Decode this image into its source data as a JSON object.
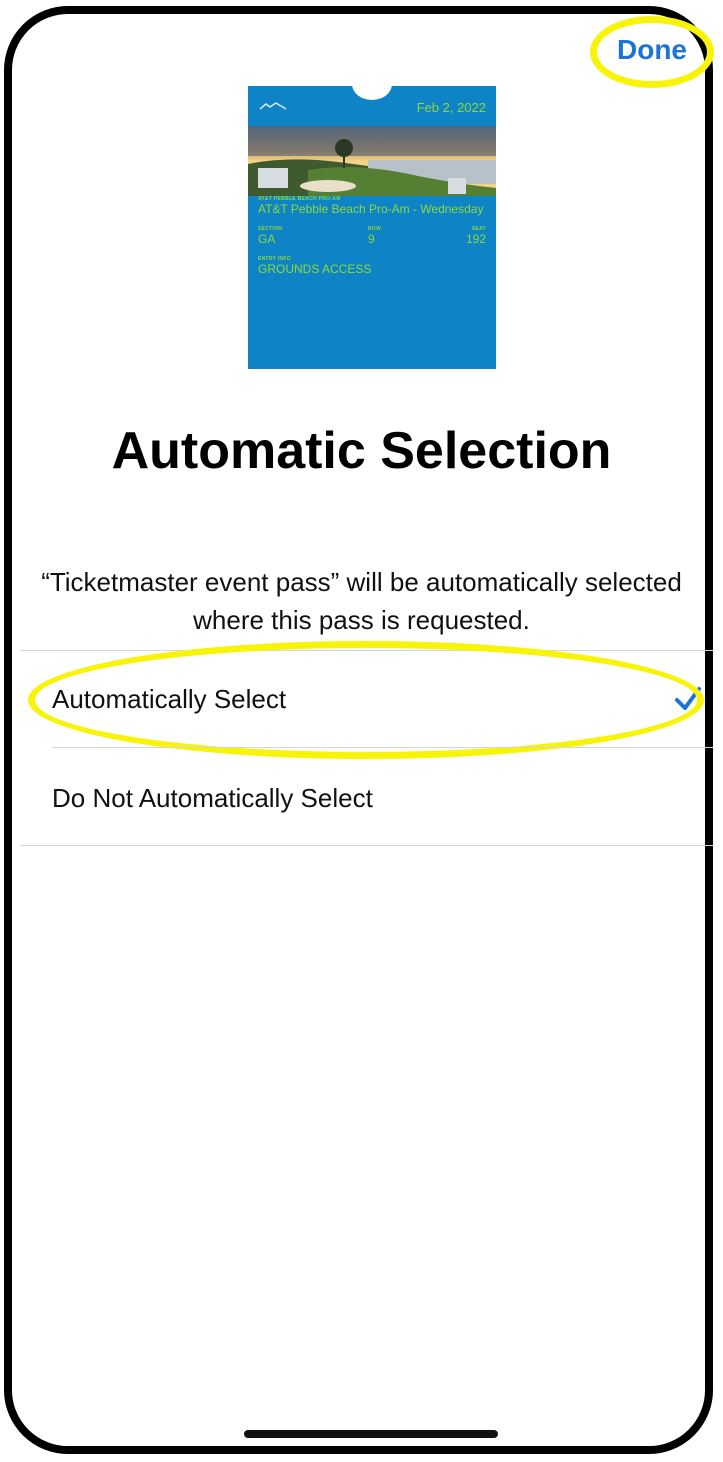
{
  "header": {
    "done_label": "Done"
  },
  "pass": {
    "date": "Feb 2, 2022",
    "logo_text": "AT&T PEBBLE BEACH PRO-AM",
    "event_label": "AT&T PEBBLE BEACH PRO-AM",
    "event_value": "AT&T Pebble Beach Pro-Am - Wednesday",
    "section_label": "SECTION",
    "section_value": "GA",
    "row_label": "ROW",
    "row_value": "9",
    "seat_label": "SEAT",
    "seat_value": "192",
    "entry_label": "ENTRY INFO",
    "entry_value": "GROUNDS ACCESS",
    "background_color": "#0e84c6",
    "text_color": "#8dd83a"
  },
  "page": {
    "title": "Automatic Selection",
    "description": "“Ticketmaster event pass” will be automatically selected where this pass is requested."
  },
  "options": [
    {
      "label": "Automatically Select",
      "selected": true
    },
    {
      "label": "Do Not Automatically Select",
      "selected": false
    }
  ],
  "colors": {
    "accent": "#1a73d9",
    "highlight": "#f7f40a"
  }
}
